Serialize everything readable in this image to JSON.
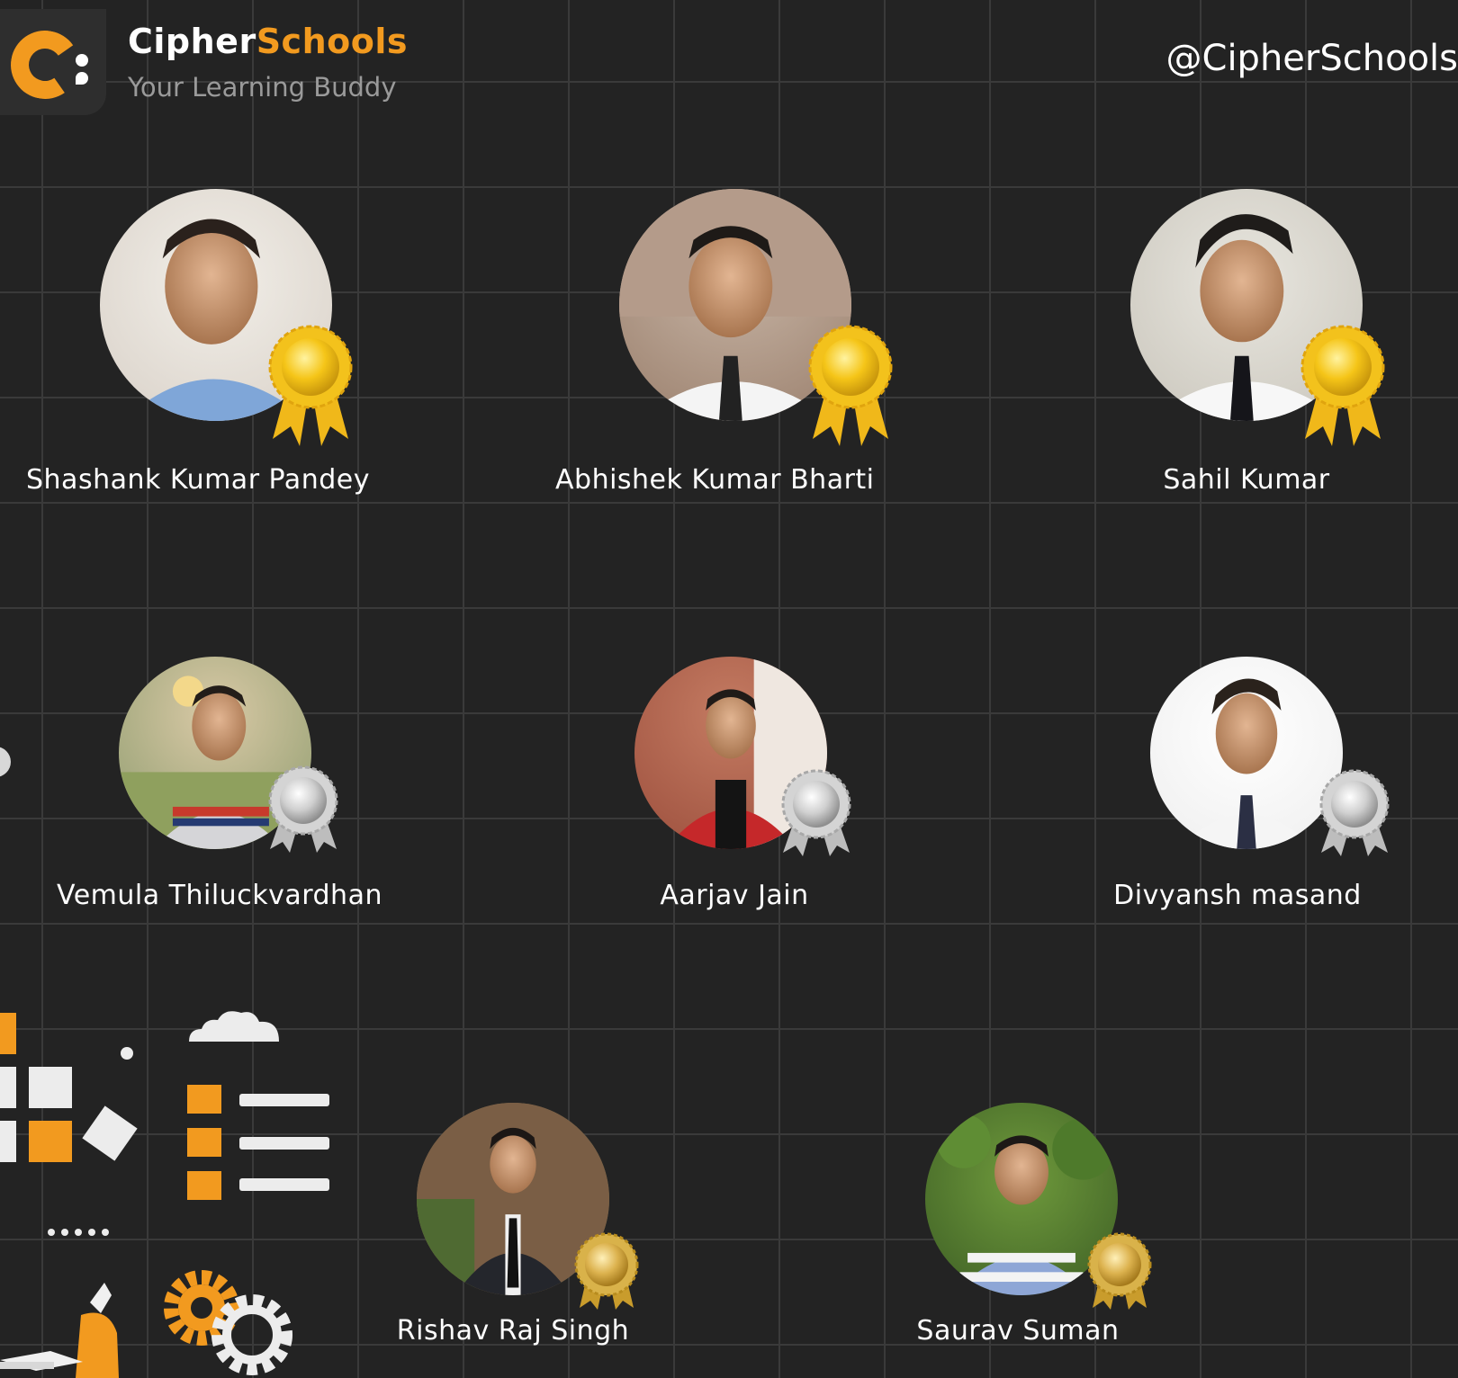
{
  "brand": {
    "name_part1": "Cipher",
    "name_part2": "Schools",
    "tagline": "Your Learning Buddy",
    "handle": "@CipherSchools"
  },
  "colors": {
    "background": "#232323",
    "grid": "#3a3a3a",
    "accent": "#f29a1f",
    "gold": "#f5c518",
    "silver": "#c9c9c9",
    "bronze": "#d9b24a"
  },
  "winners": {
    "gold": [
      {
        "name": "Shashank Kumar Pandey"
      },
      {
        "name": "Abhishek Kumar Bharti"
      },
      {
        "name": "Sahil Kumar"
      }
    ],
    "silver": [
      {
        "name": "Vemula Thiluckvardhan"
      },
      {
        "name": "Aarjav Jain"
      },
      {
        "name": "Divyansh masand"
      }
    ],
    "bronze": [
      {
        "name": "Rishav Raj Singh"
      },
      {
        "name": "Saurav Suman"
      }
    ]
  },
  "icons": {
    "logo": "cipherschools-logo-icon",
    "gold_medal": "gold-rosette-icon",
    "silver_medal": "silver-medal-icon",
    "bronze_medal": "gold-seal-icon",
    "cloud": "cloud-icon",
    "gear": "gear-icon",
    "list": "list-icon",
    "blocks": "blocks-icon",
    "person": "person-with-laptop-icon"
  }
}
